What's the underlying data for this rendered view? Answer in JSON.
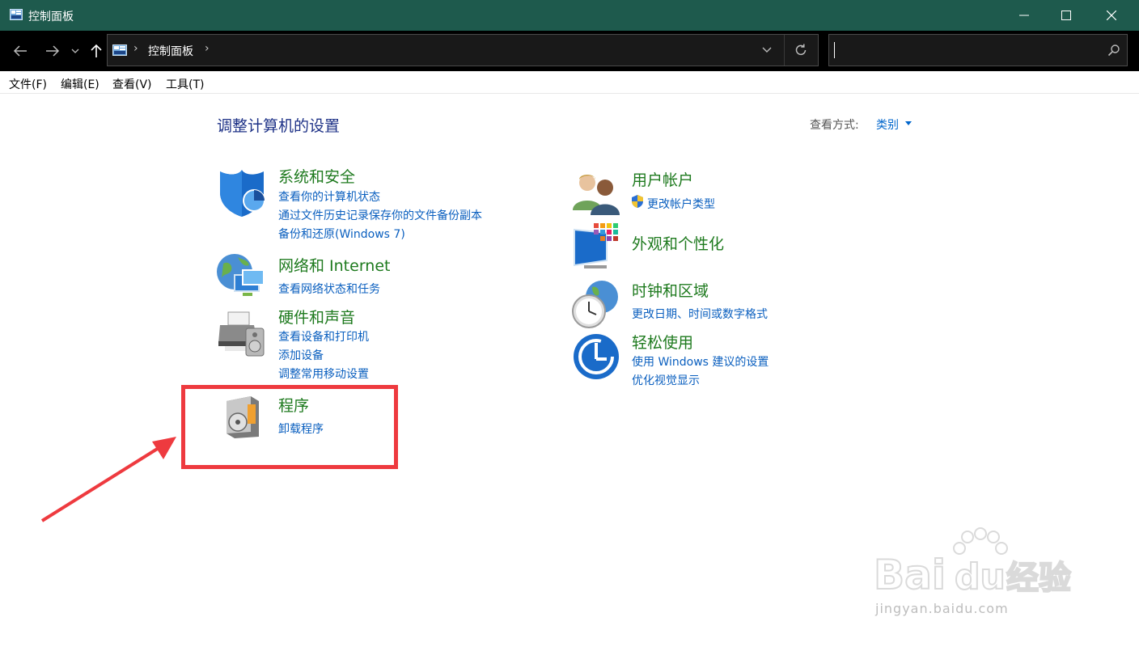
{
  "window": {
    "title": "控制面板",
    "controls": {
      "minimize": "minimize-icon",
      "maximize": "maximize-icon",
      "close": "close-icon"
    }
  },
  "navigation": {
    "breadcrumb": "控制面板",
    "search_placeholder": ""
  },
  "menu": [
    "文件(F)",
    "编辑(E)",
    "查看(V)",
    "工具(T)"
  ],
  "main": {
    "heading": "调整计算机的设置",
    "view_by_label": "查看方式:",
    "view_by_value": "类别"
  },
  "categories_left": [
    {
      "title": "系统和安全",
      "links": [
        "查看你的计算机状态",
        "通过文件历史记录保存你的文件备份副本",
        "备份和还原(Windows 7)"
      ]
    },
    {
      "title": "网络和 Internet",
      "links": [
        "查看网络状态和任务"
      ]
    },
    {
      "title": "硬件和声音",
      "links": [
        "查看设备和打印机",
        "添加设备",
        "调整常用移动设置"
      ]
    },
    {
      "title": "程序",
      "links": [
        "卸载程序"
      ]
    }
  ],
  "categories_right": [
    {
      "title": "用户帐户",
      "links": [
        "更改帐户类型"
      ]
    },
    {
      "title": "外观和个性化",
      "links": []
    },
    {
      "title": "时钟和区域",
      "links": [
        "更改日期、时间或数字格式"
      ]
    },
    {
      "title": "轻松使用",
      "links": [
        "使用 Windows 建议的设置",
        "优化视觉显示"
      ]
    }
  ],
  "annotation": {
    "color": "#ee3a3f"
  },
  "watermark": {
    "brand": "Baidu经验",
    "url": "jingyan.baidu.com"
  },
  "colors": {
    "titlebar": "#1e5a4d",
    "heading": "#1e3287",
    "category_title": "#1e7a1e",
    "link": "#0a5fbf"
  }
}
